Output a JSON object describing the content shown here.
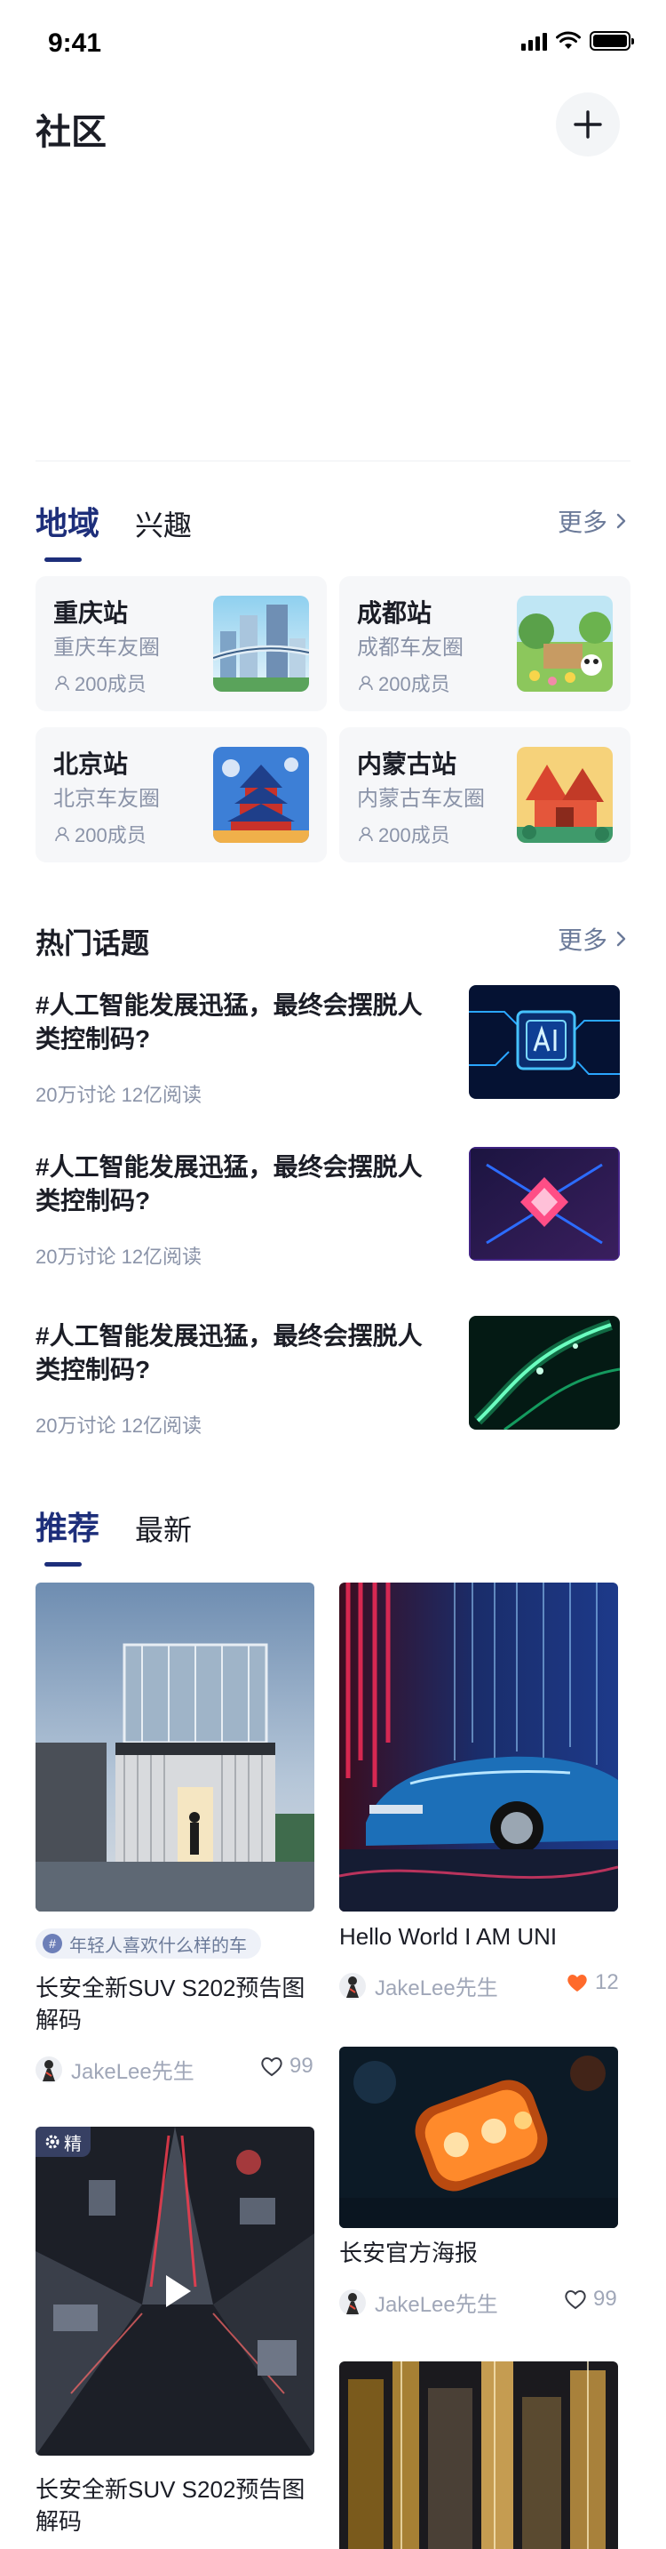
{
  "status_bar": {
    "time": "9:41"
  },
  "header": {
    "title": "社区"
  },
  "community_tabs": [
    {
      "label": "地域",
      "active": true
    },
    {
      "label": "兴趣",
      "active": false
    }
  ],
  "community_more": "更多",
  "regions": [
    {
      "name": "重庆站",
      "sub": "重庆车友圈",
      "members": "200成员"
    },
    {
      "name": "成都站",
      "sub": "成都车友圈",
      "members": "200成员"
    },
    {
      "name": "北京站",
      "sub": "北京车友圈",
      "members": "200成员"
    },
    {
      "name": "内蒙古站",
      "sub": "内蒙古车友圈",
      "members": "200成员"
    }
  ],
  "hot_topics": {
    "title": "热门话题",
    "more": "更多",
    "items": [
      {
        "title": "#人工智能发展迅猛，最终会摆脱人类控制码?",
        "meta": "20万讨论 12亿阅读"
      },
      {
        "title": "#人工智能发展迅猛，最终会摆脱人类控制码?",
        "meta": "20万讨论 12亿阅读"
      },
      {
        "title": "#人工智能发展迅猛，最终会摆脱人类控制码?",
        "meta": "20万讨论 12亿阅读"
      }
    ]
  },
  "feed_tabs": [
    {
      "label": "推荐",
      "active": true
    },
    {
      "label": "最新",
      "active": false
    }
  ],
  "feed": {
    "left": [
      {
        "tag": "年轻人喜欢什么样的车",
        "title": "长安全新SUV S202预告图解码",
        "author": "JakeLee先生",
        "likes": "99"
      },
      {
        "badge": "精",
        "title": "长安全新SUV S202预告图解码"
      }
    ],
    "right": [
      {
        "title": "Hello World I AM UNI",
        "author": "JakeLee先生",
        "likes": "12",
        "liked": true
      },
      {
        "title": "长安官方海报",
        "author": "JakeLee先生",
        "likes": "99"
      }
    ]
  },
  "colors": {
    "accent": "#1d2e7a",
    "liked": "#ff6a2b",
    "muted": "#8a93a8"
  }
}
